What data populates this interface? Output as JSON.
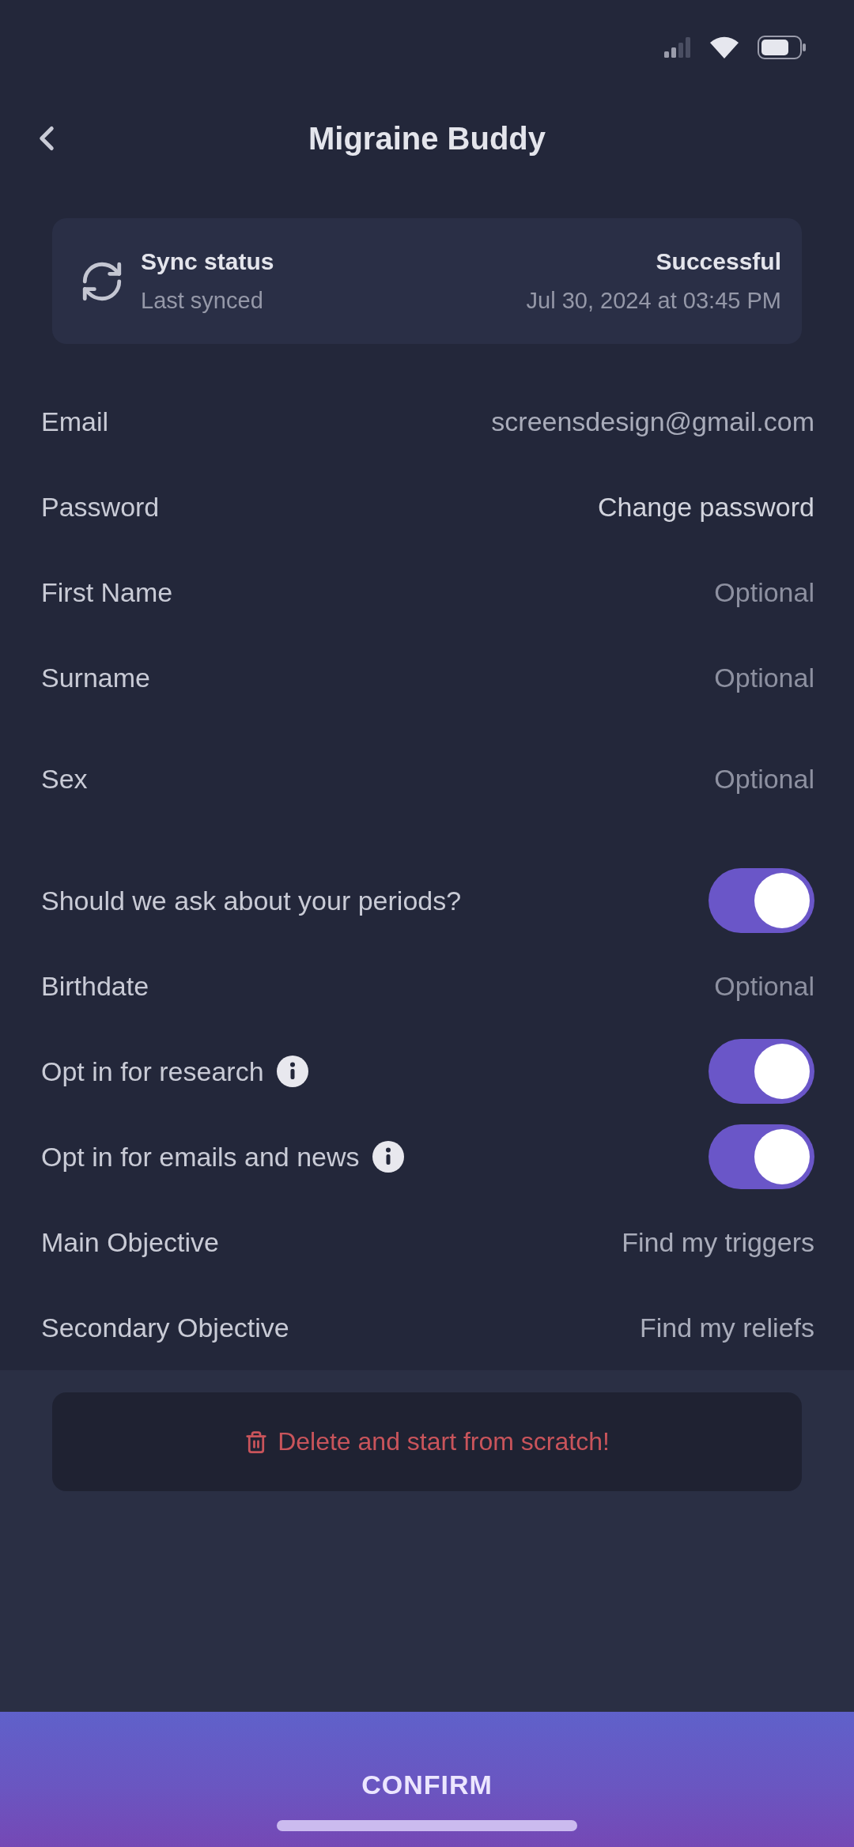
{
  "header": {
    "title": "Migraine Buddy"
  },
  "sync_card": {
    "title": "Sync status",
    "subtitle": "Last synced",
    "status": "Successful",
    "timestamp": "Jul 30, 2024 at 03:45 PM"
  },
  "settings": [
    {
      "kind": "value",
      "label": "Email",
      "value": "screensdesign@gmail.com"
    },
    {
      "kind": "link",
      "label": "Password",
      "value": "Change password"
    },
    {
      "kind": "field",
      "label": "First Name",
      "placeholder": "Optional"
    },
    {
      "kind": "field",
      "label": "Surname",
      "placeholder": "Optional"
    },
    {
      "kind": "select",
      "label": "Sex",
      "placeholder": "Optional"
    },
    {
      "kind": "toggle",
      "label": "Should we ask about your periods?",
      "on": true,
      "info": false
    },
    {
      "kind": "field",
      "label": "Birthdate",
      "placeholder": "Optional"
    },
    {
      "kind": "toggle",
      "label": "Opt in for research",
      "on": true,
      "info": true
    },
    {
      "kind": "toggle",
      "label": "Opt in for emails and news",
      "on": true,
      "info": true
    },
    {
      "kind": "value",
      "label": "Main Objective",
      "value": "Find my triggers"
    },
    {
      "kind": "value",
      "label": "Secondary Objective",
      "value": "Find my reliefs"
    }
  ],
  "delete_button": {
    "label": "Delete and start from scratch!"
  },
  "confirm_button": {
    "label": "CONFIRM"
  }
}
